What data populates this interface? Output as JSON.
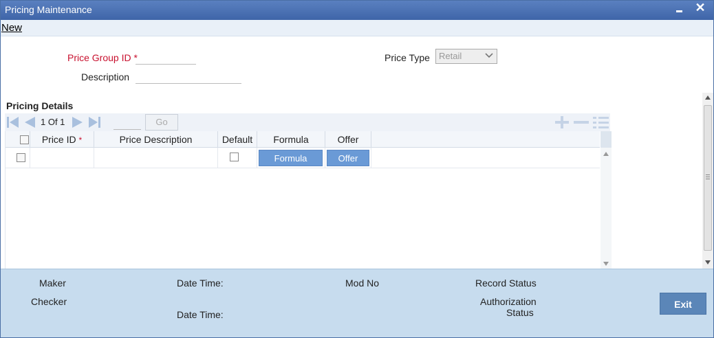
{
  "window": {
    "title": "Pricing Maintenance"
  },
  "menu": {
    "new_label": "New"
  },
  "form": {
    "price_group_id_label": "Price Group ID",
    "price_group_id_value": "",
    "required_mark": "*",
    "description_label": "Description",
    "description_value": "",
    "price_type_label": "Price Type",
    "price_type_value": "Retail"
  },
  "pricing_details": {
    "section_title": "Pricing Details",
    "pagination": {
      "text": "1 Of 1",
      "goto_value": "",
      "go_label": "Go"
    },
    "columns": [
      "Price ID",
      "Price Description",
      "Default",
      "Formula",
      "Offer"
    ],
    "rows": [
      {
        "price_id": "",
        "price_description": "",
        "default": false,
        "formula_label": "Formula",
        "offer_label": "Offer"
      }
    ]
  },
  "footer": {
    "maker_label": "Maker",
    "checker_label": "Checker",
    "date_time_label": "Date Time:",
    "date_time_label_2": "Date Time:",
    "mod_no_label": "Mod No",
    "record_status_label": "Record Status",
    "authorization_label": "Authorization",
    "status_label": "Status",
    "exit_label": "Exit"
  },
  "colors": {
    "titlebar": "#4a6fb0",
    "required": "#c8102e",
    "footer": "#c7dcee",
    "cell_button": "#6a9ad6",
    "exit_button": "#5b86b8"
  },
  "icons": [
    "minimize-icon",
    "close-icon",
    "first-page-icon",
    "prev-page-icon",
    "next-page-icon",
    "last-page-icon",
    "add-row-icon",
    "delete-row-icon",
    "single-view-icon",
    "chevron-down-icon"
  ]
}
